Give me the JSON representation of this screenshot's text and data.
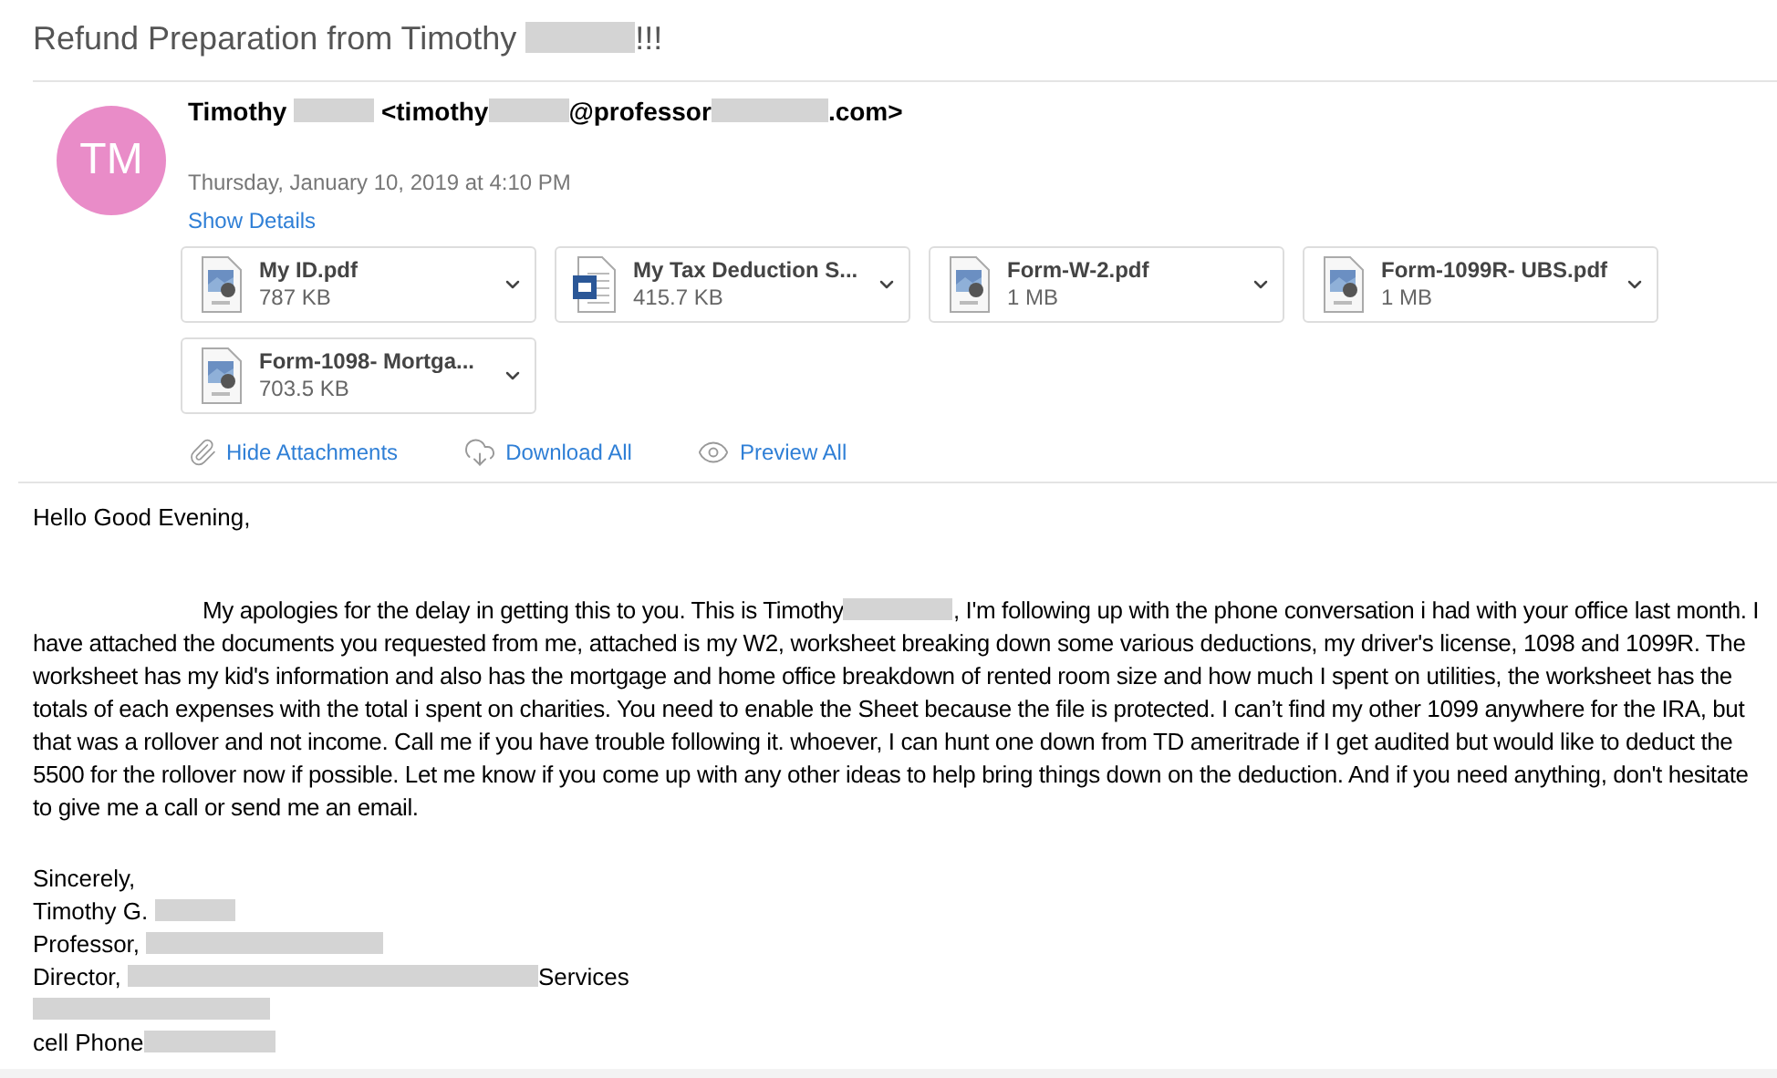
{
  "subject": [
    "Refund Preparation from Timothy ",
    {
      "kind": "redacted"
    },
    "!!!"
  ],
  "sender": {
    "initials": "TM",
    "from": [
      "Timothy ",
      {
        "kind": "redacted"
      },
      " <timothy",
      {
        "kind": "redacted"
      },
      "@professor",
      {
        "kind": "redacted"
      },
      ".com>"
    ],
    "date": "Thursday, January 10, 2019 at 4:10 PM",
    "details_link": "Show Details"
  },
  "attachments": [
    {
      "kind": "pdf",
      "name": "My ID.pdf",
      "size": "787 KB"
    },
    {
      "kind": "word",
      "name": "My Tax Deduction S...",
      "size": "415.7 KB"
    },
    {
      "kind": "pdf",
      "name": "Form-W-2.pdf",
      "size": "1 MB"
    },
    {
      "kind": "pdf",
      "name": "Form-1099R- UBS.pdf",
      "size": "1 MB"
    },
    {
      "kind": "pdf",
      "name": "Form-1098- Mortga...",
      "size": "703.5 KB"
    }
  ],
  "attachment_actions": [
    {
      "kind": "hide",
      "label": "Hide Attachments"
    },
    {
      "kind": "download",
      "label": "Download All"
    },
    {
      "kind": "preview",
      "label": "Preview All"
    }
  ],
  "body": {
    "greeting": "Hello Good Evening,",
    "paragraph": [
      "My apologies for the delay in getting this to you. This is Timothy",
      {
        "kind": "redacted"
      },
      ", I'm following up with the phone conversation i had with your office last month. I have attached the documents you requested from me, attached is my W2, worksheet breaking down some various deductions, my driver's license, 1098 and 1099R. The worksheet has my kid's information and also has the mortgage and home office breakdown of rented room size and how much I spent on utilities, the worksheet has the totals of each expenses with the total i spent on charities. You need to enable the Sheet because the file is protected. I can’t find my other 1099 anywhere for the IRA, but that was a rollover and not income. Call me if you have trouble following it. whoever, I can hunt one down from TD ameritrade if I get audited but would like to deduct the 5500 for the rollover now if possible. Let me know if you come up with any other ideas to help bring things down on the deduction. And if you need anything, don't hesitate to give me a call or send me an email."
    ],
    "signature": [
      [
        "Sincerely,"
      ],
      [
        "Timothy G. ",
        {
          "kind": "redacted"
        }
      ],
      [
        "Professor, ",
        {
          "kind": "redacted"
        }
      ],
      [
        "Director, ",
        {
          "kind": "redacted"
        },
        "Services"
      ],
      [
        {
          "kind": "redacted"
        }
      ],
      [
        "cell Phone",
        {
          "kind": "redacted"
        }
      ]
    ]
  }
}
